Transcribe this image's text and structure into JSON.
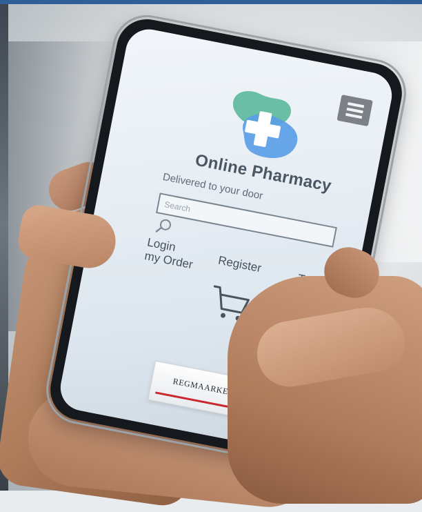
{
  "app": {
    "title": "Online Pharmacy",
    "tagline": "Delivered to your door"
  },
  "search": {
    "placeholder": "Search",
    "icon": "search-icon"
  },
  "nav": {
    "login_line1": "Login",
    "login_line2": "my Order",
    "register": "Register",
    "track": "Track"
  },
  "product": {
    "box_label": "REGMAARKER"
  },
  "icons": {
    "menu": "hamburger-menu-icon",
    "cart": "shopping-cart-icon",
    "chat": "more-dots-icon",
    "logo": "pharmacy-cross-logo"
  },
  "colors": {
    "accent": "#2f9fe6",
    "logo_green": "#5bb89a",
    "logo_blue": "#5aa0e6",
    "menu_bg": "#7c8187",
    "top_bar": "#2f5f96"
  }
}
